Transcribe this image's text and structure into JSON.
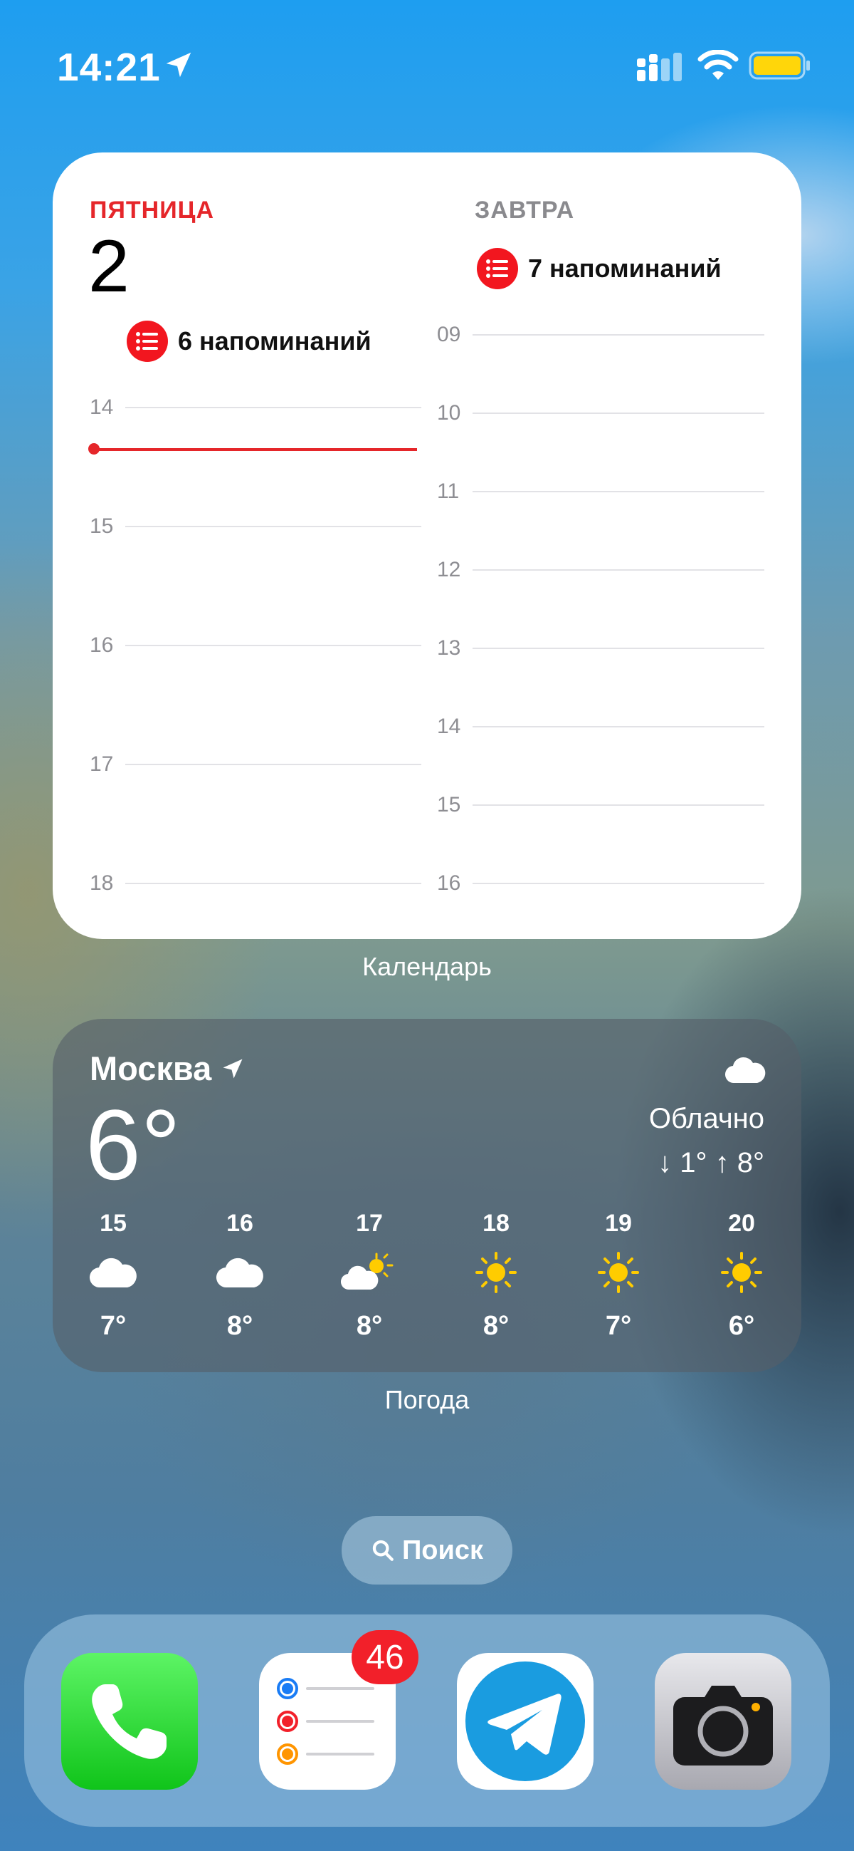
{
  "status_bar": {
    "time": "14:21",
    "battery_color": "#ffd60a"
  },
  "calendar_widget": {
    "today_label": "ПЯТНИЦА",
    "today_date": "2",
    "today_reminders": "6 напоминаний",
    "today_hours": [
      "14",
      "15",
      "16",
      "17",
      "18"
    ],
    "tomorrow_label": "ЗАВТРА",
    "tomorrow_reminders": "7 напоминаний",
    "tomorrow_hours": [
      "09",
      "10",
      "11",
      "12",
      "13",
      "14",
      "15",
      "16"
    ],
    "widget_name": "Календарь"
  },
  "weather_widget": {
    "city": "Москва",
    "temperature": "6°",
    "condition": "Облачно",
    "range": "↓ 1° ↑ 8°",
    "forecast": [
      {
        "day": "15",
        "icon": "cloud-icon",
        "temp": "7°"
      },
      {
        "day": "16",
        "icon": "cloud-icon",
        "temp": "8°"
      },
      {
        "day": "17",
        "icon": "partly-sunny-icon",
        "temp": "8°"
      },
      {
        "day": "18",
        "icon": "sun-icon",
        "temp": "8°"
      },
      {
        "day": "19",
        "icon": "sun-icon",
        "temp": "7°"
      },
      {
        "day": "20",
        "icon": "sun-icon",
        "temp": "6°"
      }
    ],
    "widget_name": "Погода"
  },
  "search": {
    "label": "Поиск"
  },
  "dock": {
    "apps": [
      {
        "name": "phone-app-icon"
      },
      {
        "name": "reminders-app-icon",
        "badge": "46"
      },
      {
        "name": "telegram-app-icon"
      },
      {
        "name": "camera-app-icon"
      }
    ]
  }
}
